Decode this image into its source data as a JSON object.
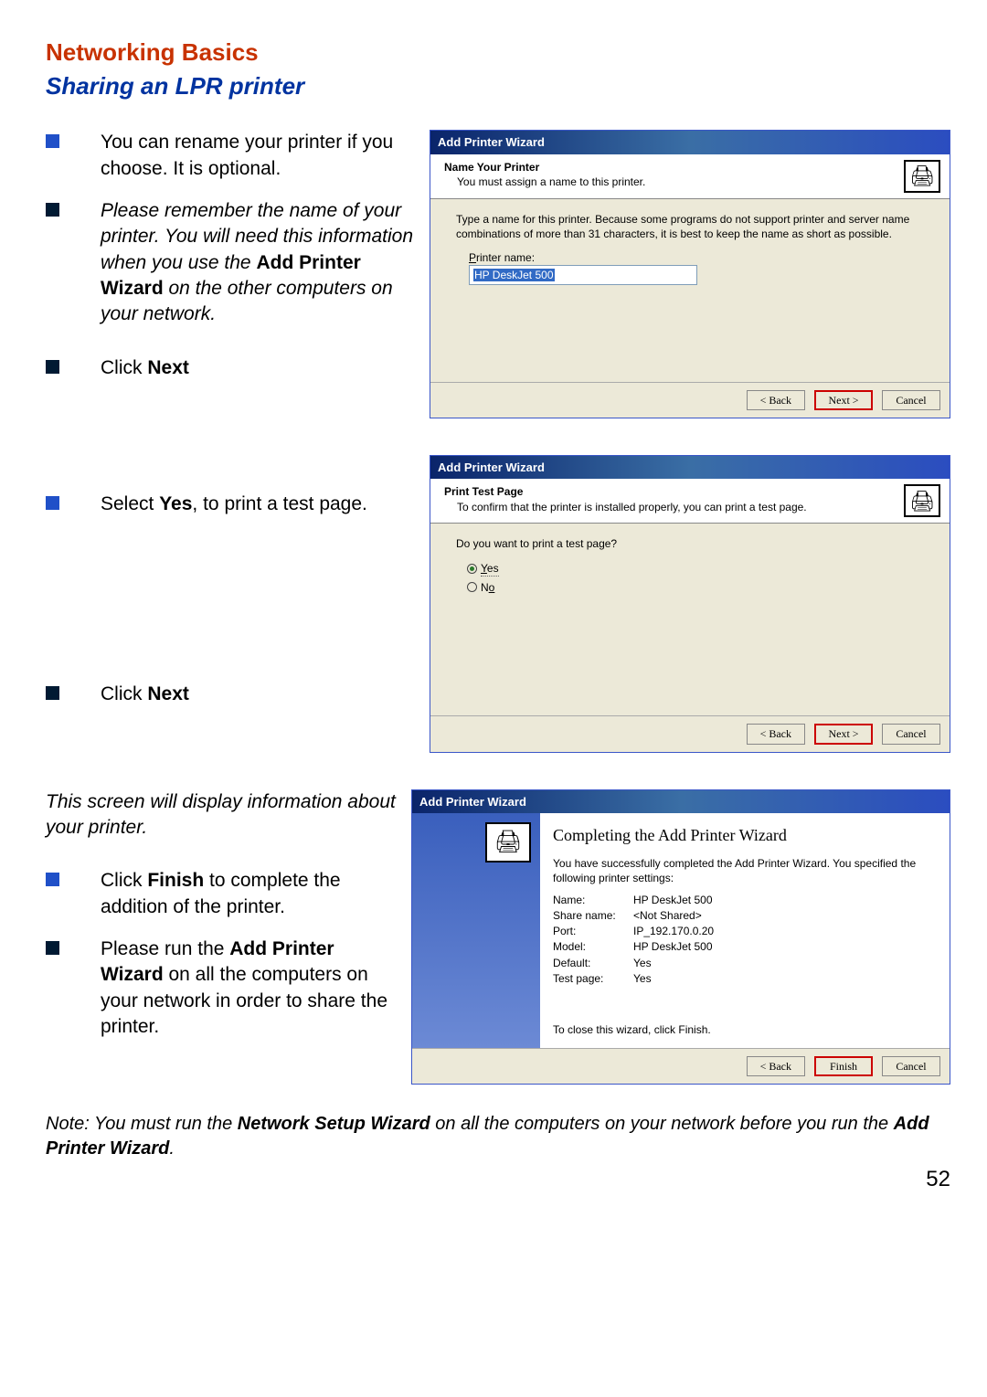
{
  "headings": {
    "main": "Networking Basics",
    "sub": "Sharing an LPR printer"
  },
  "section1": {
    "bullets": {
      "b1": "You can rename your printer if you choose.  It is optional.",
      "b2": "Please remember the name of your printer.  You will need this information when you use the ",
      "b2bold": "Add Printer Wizard",
      "b2cont": " on the other computers on your network.",
      "b3pre": "Click ",
      "b3bold": "Next"
    }
  },
  "section2": {
    "bullets": {
      "b1pre": "Select ",
      "b1bold": "Yes",
      "b1post": ", to print a test page.",
      "b2pre": "Click ",
      "b2bold": "Next"
    }
  },
  "section3": {
    "intro": "This screen will display information about your printer.",
    "b1pre": "Click ",
    "b1bold": "Finish",
    "b1post": " to complete the addition of the printer.",
    "b2pre": "Please run the ",
    "b2bold": "Add Printer Wizard",
    "b2post": " on all the computers on your network in order to share the printer."
  },
  "note": {
    "pre": "Note:  You must run the ",
    "bold1": "Network Setup Wizard",
    "mid": " on all the computers on your network before you run the ",
    "bold2": "Add Printer Wizard",
    "post": "."
  },
  "pagenum": "52",
  "wizard1": {
    "title": "Add Printer Wizard",
    "h1": "Name Your Printer",
    "h2": "You must assign a name to this printer.",
    "body1": "Type a name for this printer. Because some programs do not support printer and server name combinations of more than 31 characters, it is best to keep the name as short as possible.",
    "label": "Printer name:",
    "value": "HP DeskJet 500",
    "back": "< Back",
    "next": "Next >",
    "cancel": "Cancel"
  },
  "wizard2": {
    "title": "Add Printer Wizard",
    "h1": "Print Test Page",
    "h2": "To confirm that the printer is installed properly, you can print a test page.",
    "q": "Do you want to print a test page?",
    "yes": "Yes",
    "no": "No",
    "back": "< Back",
    "next": "Next >",
    "cancel": "Cancel"
  },
  "wizard3": {
    "title": "Add Printer Wizard",
    "h1": "Completing the Add Printer Wizard",
    "sub1": "You have successfully completed the Add Printer Wizard. You specified the following printer settings:",
    "settings": {
      "Name": "HP DeskJet 500",
      "ShareName": "<Not Shared>",
      "Port": "IP_192.170.0.20",
      "Model": "HP DeskJet 500",
      "Default": "Yes",
      "TestPage": "Yes"
    },
    "labels": {
      "Name": "Name:",
      "ShareName": "Share name:",
      "Port": "Port:",
      "Model": "Model:",
      "Default": "Default:",
      "TestPage": "Test page:"
    },
    "close": "To close this wizard, click Finish.",
    "back": "< Back",
    "finish": "Finish",
    "cancel": "Cancel"
  }
}
